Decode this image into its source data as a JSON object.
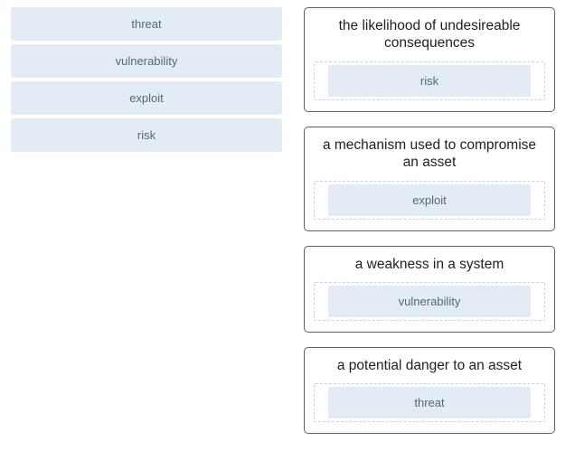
{
  "terms": [
    {
      "label": "threat"
    },
    {
      "label": "vulnerability"
    },
    {
      "label": "exploit"
    },
    {
      "label": "risk"
    }
  ],
  "definitions": [
    {
      "text": "the likelihood of undesireable consequences",
      "answer": "risk"
    },
    {
      "text": "a mechanism used to compromise an asset",
      "answer": "exploit"
    },
    {
      "text": "a weakness in a system",
      "answer": "vulnerability"
    },
    {
      "text": "a potential danger to an asset",
      "answer": "threat"
    }
  ]
}
